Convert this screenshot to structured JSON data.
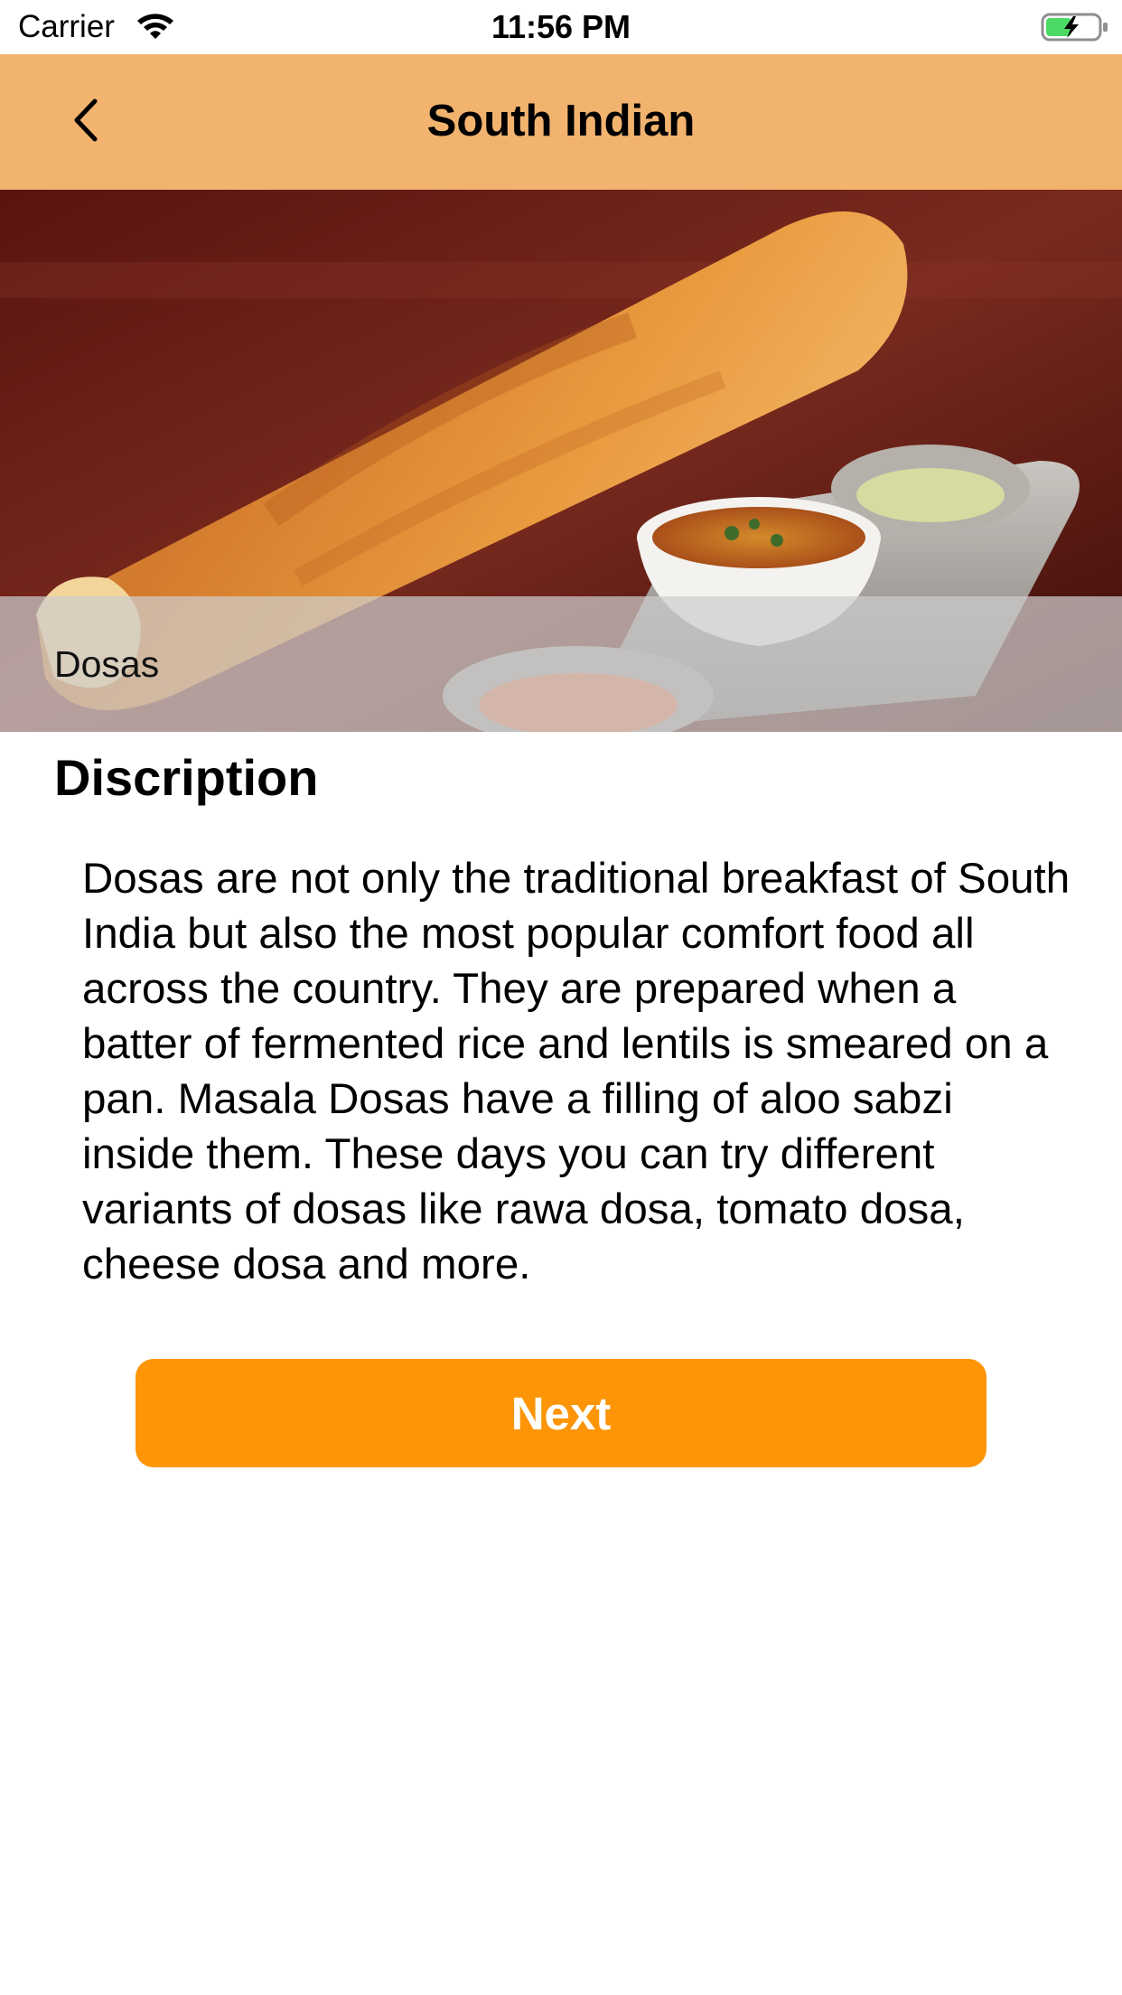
{
  "status_bar": {
    "carrier": "Carrier",
    "time": "11:56 PM"
  },
  "nav": {
    "title": "South Indian",
    "back_icon": "chevron-left-icon"
  },
  "hero": {
    "caption": "Dosas"
  },
  "description": {
    "heading": "Discription",
    "body": "Dosas are not only the traditional breakfast of South India but also the most popular comfort food all across the country. They are prepared when a batter of fermented rice and lentils is smeared on a pan. Masala Dosas have a filling of aloo sabzi inside them. These days you can try different variants of dosas like rawa dosa, tomato dosa, cheese dosa and more."
  },
  "actions": {
    "next_label": "Next"
  },
  "colors": {
    "nav_background": "#f2b36f",
    "button_background": "#fd9506",
    "battery_charge": "#4cd964"
  }
}
